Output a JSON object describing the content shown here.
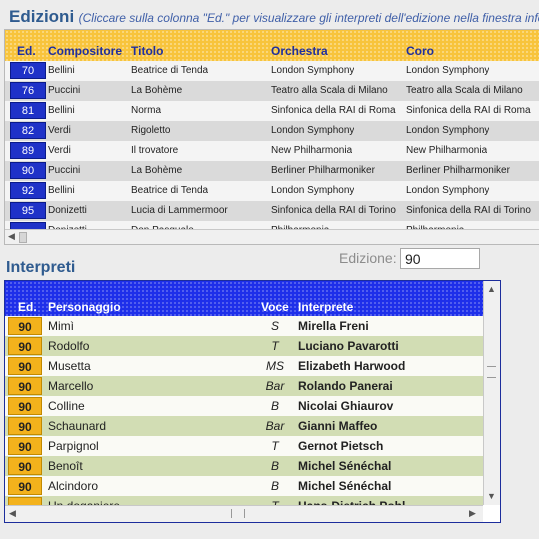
{
  "edizioni": {
    "title": "Edizioni",
    "subtitle": "(Cliccare sulla colonna \"Ed.\" per visualizzare gli interpreti dell'edizione nella finestra inferiore)",
    "columns": [
      "Ed.",
      "Compositore",
      "Titolo",
      "Orchestra",
      "Coro"
    ],
    "rows": [
      [
        "70",
        "Bellini",
        "Beatrice di Tenda",
        "London Symphony",
        "London Symphony"
      ],
      [
        "76",
        "Puccini",
        "La Bohème",
        "Teatro alla Scala di Milano",
        "Teatro alla Scala di Milano"
      ],
      [
        "81",
        "Bellini",
        "Norma",
        "Sinfonica della RAI di Roma",
        "Sinfonica della RAI di Roma"
      ],
      [
        "82",
        "Verdi",
        "Rigoletto",
        "London Symphony",
        "London Symphony"
      ],
      [
        "89",
        "Verdi",
        "Il trovatore",
        "New Philharmonia",
        "New Philharmonia"
      ],
      [
        "90",
        "Puccini",
        "La Bohème",
        "Berliner Philharmoniker",
        "Berliner Philharmoniker"
      ],
      [
        "92",
        "Bellini",
        "Beatrice di Tenda",
        "London Symphony",
        "London Symphony"
      ],
      [
        "95",
        "Donizetti",
        "Lucia di Lammermoor",
        "Sinfonica della RAI di Torino",
        "Sinfonica della RAI di Torino"
      ]
    ],
    "partial_row": [
      "",
      "Donizetti",
      "Don Pasquale",
      "Philharmonia",
      "Philharmonia"
    ]
  },
  "edizione_filter": {
    "label": "Edizione:",
    "value": "90"
  },
  "interpreti": {
    "title": "Interpreti",
    "columns": [
      "Ed.",
      "Personaggio",
      "Voce",
      "Interprete"
    ],
    "rows": [
      [
        "90",
        "Mimì",
        "S",
        "Mirella Freni"
      ],
      [
        "90",
        "Rodolfo",
        "T",
        "Luciano Pavarotti"
      ],
      [
        "90",
        "Musetta",
        "MS",
        "Elizabeth Harwood"
      ],
      [
        "90",
        "Marcello",
        "Bar",
        "Rolando Panerai"
      ],
      [
        "90",
        "Colline",
        "B",
        "Nicolai Ghiaurov"
      ],
      [
        "90",
        "Schaunard",
        "Bar",
        "Gianni Maffeo"
      ],
      [
        "90",
        "Parpignol",
        "T",
        "Gernot Pietsch"
      ],
      [
        "90",
        "Benoît",
        "B",
        "Michel Sénéchal"
      ],
      [
        "90",
        "Alcindoro",
        "B",
        "Michel Sénéchal"
      ]
    ],
    "partial_row": [
      "",
      "Un doganiere",
      "T",
      "Hans-Dietrich Pohl"
    ]
  },
  "colors": {
    "header_edizioni": "#F8C43C",
    "header_interpreti": "#1E2FEA",
    "ed_cell_blue": "#1F32C8",
    "ed_cell_orange": "#F3B21C",
    "row_green": "#D2DDB4",
    "title_blue": "#2F5B8F"
  },
  "icons": [
    "scroll-left-arrow-icon",
    "scroll-right-arrow-icon",
    "scroll-up-arrow-icon",
    "scroll-down-arrow-icon"
  ]
}
